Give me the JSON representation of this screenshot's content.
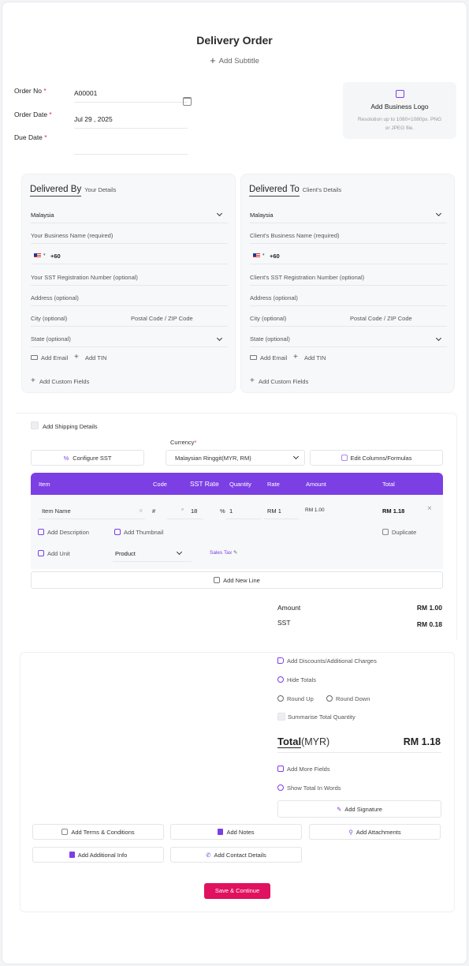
{
  "header": {
    "title": "Delivery Order",
    "add_subtitle": "Add Subtitle"
  },
  "meta": {
    "order_no_label": "Order No",
    "order_no_value": "A00001",
    "order_date_label": "Order Date",
    "order_date_value": "Jul 29 , 2025",
    "due_date_label": "Due Date",
    "required_mark": "*"
  },
  "logo": {
    "title": "Add Business Logo",
    "hint_line1": "Resolution up to 1080×1080px. PNG",
    "hint_line2": "or JPEG file."
  },
  "delivered_by": {
    "title": "Delivered By",
    "subtitle": "Your Details",
    "country": "Malaysia",
    "business_name": "Your Business Name (required)",
    "phone_code": "+60",
    "sst": "Your SST Registration Number (optional)",
    "address": "Address (optional)",
    "city": "City (optional)",
    "postal": "Postal Code / ZIP Code",
    "state": "State (optional)",
    "add_email": "Add Email",
    "add_tin": "Add TIN",
    "add_custom": "Add Custom Fields"
  },
  "delivered_to": {
    "title": "Delivered To",
    "subtitle": "Client's Details",
    "country": "Malaysia",
    "business_name": "Client's Business Name (required)",
    "phone_code": "+60",
    "sst": "Client's SST Registration Number (optional)",
    "address": "Address (optional)",
    "city": "City (optional)",
    "postal": "Postal Code / ZIP Code",
    "state": "State (optional)",
    "add_email": "Add Email",
    "add_tin": "Add TIN",
    "add_custom": "Add Custom Fields"
  },
  "shipping": {
    "label": "Add Shipping Details"
  },
  "toolbar": {
    "configure_sst": "Configure SST",
    "currency_label": "Currency",
    "currency_value": "Malaysian Ringgit(MYR, RM)",
    "edit_columns": "Edit Columns/Formulas"
  },
  "table": {
    "headers": {
      "item": "Item",
      "code": "Code",
      "sst_rate": "SST Rate",
      "quantity": "Quantity",
      "rate": "Rate",
      "amount": "Amount",
      "total": "Total"
    },
    "row": {
      "item_name": "Item Name",
      "code": "#",
      "sst_rate": "18",
      "sst_unit": "%",
      "quantity": "1",
      "rate": "RM 1",
      "amount": "RM 1.00",
      "total": "RM 1.18"
    },
    "add_description": "Add Description",
    "add_thumbnail": "Add Thumbnail",
    "duplicate": "Duplicate",
    "add_unit": "Add Unit",
    "product": "Product",
    "sales_tax": "Sales Tax",
    "add_new_line": "Add New Line"
  },
  "summary": {
    "amount_label": "Amount",
    "amount_value": "RM 1.00",
    "sst_label": "SST",
    "sst_value": "RM 0.18",
    "add_discounts": "Add Discounts/Additional Charges",
    "hide_totals": "Hide Totals",
    "round_up": "Round Up",
    "round_down": "Round Down",
    "summarise_qty": "Summarise Total Quantity",
    "total_label": "Total",
    "total_currency": "(MYR)",
    "total_value": "RM 1.18",
    "add_more_fields": "Add More Fields",
    "show_words": "Show Total In Words",
    "add_signature": "Add Signature"
  },
  "extras": {
    "terms": "Add Terms & Conditions",
    "notes": "Add Notes",
    "attachments": "Add Attachments",
    "additional_info": "Add Additional Info",
    "contact_details": "Add Contact Details"
  },
  "actions": {
    "save": "Save & Continue"
  },
  "colors": {
    "accent": "#7b3fe4",
    "primary_button": "#e0115f"
  }
}
